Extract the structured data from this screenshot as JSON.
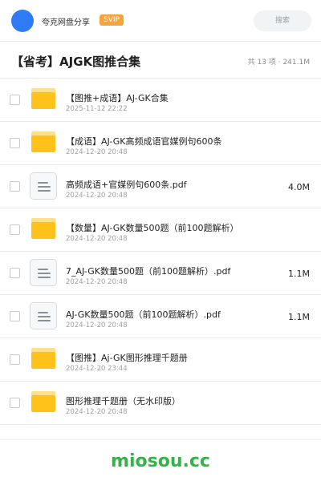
{
  "header": {
    "username": "夸克网盘分享",
    "badge": "SVIP",
    "search_placeholder": "搜索"
  },
  "share": {
    "title": "【省考】AJGK图推合集",
    "meta": "共 13 项 · 241.1M"
  },
  "files": [
    {
      "type": "folder",
      "name": "【图推+成语】AJ-GK合集",
      "date": "2025-11-12 22:22",
      "size": ""
    },
    {
      "type": "folder",
      "name": "【成语】AJ-GK高频成语官媒例句600条",
      "date": "2024-12-20 20:48",
      "size": ""
    },
    {
      "type": "doc",
      "name": "高频成语+官媒例句600条.pdf",
      "date": "2024-12-20 20:48",
      "size": "4.0M"
    },
    {
      "type": "folder",
      "name": "【数量】AJ-GK数量500题（前100题解析）",
      "date": "2024-12-20 20:48",
      "size": ""
    },
    {
      "type": "doc",
      "name": "7_AJ-GK数量500题（前100题解析）.pdf",
      "date": "2024-12-20 20:48",
      "size": "1.1M"
    },
    {
      "type": "doc",
      "name": "AJ-GK数量500题（前100题解析）.pdf",
      "date": "2024-12-20 20:48",
      "size": "1.1M"
    },
    {
      "type": "folder",
      "name": "【图推】Aj-GK图形推理千题册",
      "date": "2024-12-20 23:44",
      "size": ""
    },
    {
      "type": "folder",
      "name": "图形推理千题册（无水印版）",
      "date": "2024-12-20 20:48",
      "size": ""
    }
  ],
  "footer": {
    "brand": "miosou.cc"
  },
  "colors": {
    "avatar": "#2f7bf5",
    "badge": "#f7a23b",
    "folder": "#ffc21a",
    "brand": "#35b34a"
  }
}
